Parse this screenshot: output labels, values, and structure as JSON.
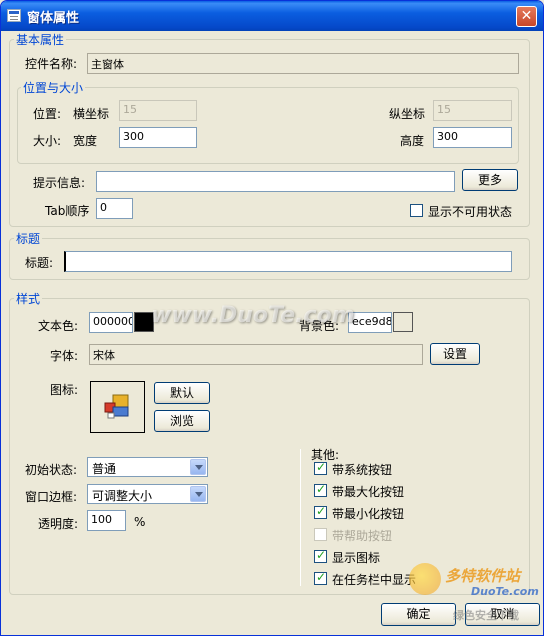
{
  "window": {
    "title": "窗体属性",
    "close_glyph": "✕"
  },
  "basic": {
    "group_label": "基本属性",
    "control_name_label": "控件名称:",
    "control_name_value": "主窗体",
    "position_group_label": "位置与大小",
    "position_label": "位置:",
    "x_label": "横坐标",
    "x_value": "15",
    "y_label": "纵坐标",
    "y_value": "15",
    "size_label": "大小:",
    "width_label": "宽度",
    "width_value": "300",
    "height_label": "高度",
    "height_value": "300",
    "hint_label": "提示信息:",
    "hint_value": "",
    "more_button": "更多",
    "tab_order_label": "Tab顺序",
    "tab_order_value": "0",
    "show_disabled_label": "显示不可用状态",
    "show_disabled_checked": false
  },
  "title_group": {
    "group_label": "标题",
    "title_label": "标题:",
    "title_value": ""
  },
  "style": {
    "group_label": "样式",
    "text_color_label": "文本色:",
    "text_color_value": "000000",
    "text_color_hex": "#000000",
    "bg_color_label": "背景色:",
    "bg_color_value": "ece9d8",
    "bg_color_hex": "#ece9d8",
    "font_label": "字体:",
    "font_value": "宋体",
    "font_set_button": "设置",
    "icon_label": "图标:",
    "icon_default_button": "默认",
    "icon_browse_button": "浏览",
    "init_state_label": "初始状态:",
    "init_state_value": "普通",
    "border_label": "窗口边框:",
    "border_value": "可调整大小",
    "opacity_label": "透明度:",
    "opacity_value": "100",
    "opacity_unit": "%",
    "other_label": "其他:",
    "others": [
      {
        "label": "带系统按钮",
        "checked": true,
        "enabled": true
      },
      {
        "label": "带最大化按钮",
        "checked": true,
        "enabled": true
      },
      {
        "label": "带最小化按钮",
        "checked": true,
        "enabled": true
      },
      {
        "label": "带帮助按钮",
        "checked": false,
        "enabled": false
      },
      {
        "label": "显示图标",
        "checked": true,
        "enabled": true
      },
      {
        "label": "在任务栏中显示",
        "checked": true,
        "enabled": true
      }
    ]
  },
  "footer": {
    "ok_button": "确定",
    "cancel_button": "取消"
  },
  "watermark": {
    "text": "www.DuoTe.com",
    "logo_text": "多特软件站",
    "logo_sub": "DuoTe.com",
    "logo_tagline": "绿色安全下载"
  }
}
